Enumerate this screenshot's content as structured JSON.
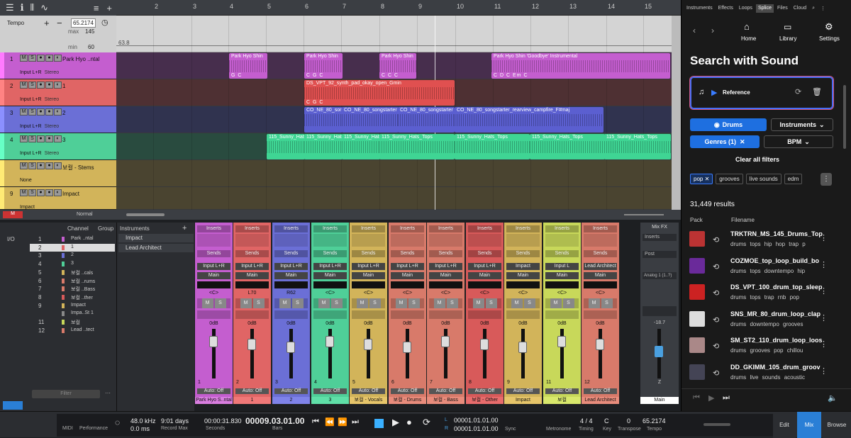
{
  "ruler": {
    "bars": [
      "2",
      "3",
      "4",
      "5",
      "6",
      "7",
      "8",
      "9",
      "10",
      "11",
      "12",
      "13",
      "14",
      "15"
    ]
  },
  "tempo": {
    "label": "Tempo",
    "value": "65.2174",
    "max_label": "max",
    "max": "145",
    "min_label": "min",
    "min": "60",
    "lane_value": "63.8"
  },
  "tracks": [
    {
      "num": "1",
      "name": "Park Hyo ..ntal",
      "input": "Input L+R",
      "mode": "Stereo",
      "color": "#c45ecf"
    },
    {
      "num": "2",
      "name": "1",
      "input": "Input L+R",
      "mode": "Stereo",
      "color": "#e06565"
    },
    {
      "num": "3",
      "name": "2",
      "input": "Input L+R",
      "mode": "Stereo",
      "color": "#6b6fd6"
    },
    {
      "num": "4",
      "name": "3",
      "input": "Input L+R",
      "mode": "Stereo",
      "color": "#4fcf98"
    },
    {
      "num": "",
      "name": "보컬 - Stems",
      "input": "None",
      "mode": "",
      "color": "#d2b45a"
    },
    {
      "num": "9",
      "name": "Impact",
      "input": "Impact",
      "mode": "",
      "color": "#d2b45a"
    }
  ],
  "clips": {
    "park": "Park Hyo Shin",
    "park_goodbye": "Park Hyo Shin 'Goodbye' Instrumental",
    "synth": "DS_VPT_92_synth_pad_okay_open_Gmin",
    "co_short": "CO_NE_80_sor",
    "co_song": "CO_NE_80_songstarter",
    "co_full": "CO_NE_80_songstarter_rearview_campfire_F#maj",
    "hats_a": "115_Sunny_Hats",
    "hats_b": "115_Sunny_Hats_Tops",
    "chords_1": "G  C",
    "chords_2": "C  G  C",
    "chords_3": "Em",
    "chords_4": "C  D  C  Em  C",
    "chords_5": "C  C  C"
  },
  "arrange_bottom": {
    "mode": "Normal"
  },
  "console": {
    "channel_col": "Channel",
    "group_col": "Group",
    "instruments_title": "Instruments",
    "instruments": [
      "Impact",
      "Lead Architect"
    ],
    "io": "I/O",
    "channels": [
      {
        "n": "1",
        "name": "Park ..ntal"
      },
      {
        "n": "2",
        "name": "1"
      },
      {
        "n": "3",
        "name": "2"
      },
      {
        "n": "4",
        "name": "3"
      },
      {
        "n": "5",
        "name": "보컬 ..cals"
      },
      {
        "n": "6",
        "name": "보컬 ..rums"
      },
      {
        "n": "7",
        "name": "보컬 ..Bass"
      },
      {
        "n": "8",
        "name": "보컬 ..ther"
      },
      {
        "n": "9",
        "name": "Impact"
      },
      {
        "n": "",
        "name": "Impa..St 1"
      },
      {
        "n": "11",
        "name": "보컬"
      },
      {
        "n": "12",
        "name": "Lead ..tect"
      }
    ],
    "filter_placeholder": "Filter",
    "strip_inserts": "Inserts",
    "strip_sends": "Sends",
    "strip_main": "Main",
    "strip_auto": "Auto: Off",
    "strip_db": "0dB",
    "strips": [
      {
        "n": "1",
        "input": "Input L+R",
        "pan": "<C>",
        "name": "Park Hyo S..ntal",
        "color": "#c45ecf",
        "nc": "#d97ee0"
      },
      {
        "n": "2",
        "input": "Input L+R",
        "pan": "L70",
        "name": "1",
        "color": "#e06565",
        "nc": "#f07878"
      },
      {
        "n": "3",
        "input": "Input L+R",
        "pan": "R62",
        "name": "2",
        "color": "#6b6fd6",
        "nc": "#7f83ea"
      },
      {
        "n": "4",
        "input": "Input L+R",
        "pan": "<C>",
        "name": "3",
        "color": "#4fcf98",
        "nc": "#5fe0a8"
      },
      {
        "n": "5",
        "input": "Input L+R",
        "pan": "<C>",
        "name": "보컬 - Vocals",
        "color": "#d2b45a",
        "nc": "#e6c56a"
      },
      {
        "n": "6",
        "input": "Input L+R",
        "pan": "<C>",
        "name": "보컬 - Drums",
        "color": "#d87a6a",
        "nc": "#e88c7c"
      },
      {
        "n": "7",
        "input": "Input L+R",
        "pan": "<C>",
        "name": "보컬 - Bass",
        "color": "#d87a6a",
        "nc": "#e88c7c"
      },
      {
        "n": "8",
        "input": "Input L+R",
        "pan": "<C>",
        "name": "보컬 - Other",
        "color": "#d85a5a",
        "nc": "#e86c6c"
      },
      {
        "n": "9",
        "input": "Impact",
        "pan": "<C>",
        "name": "Impact",
        "color": "#d2b45a",
        "nc": "#e6c56a"
      },
      {
        "n": "11",
        "input": "Input L",
        "pan": "<C>",
        "name": "보컬",
        "color": "#c8d85a",
        "nc": "#d8e86c"
      },
      {
        "n": "12",
        "input": "Lead Architect",
        "pan": "<C>",
        "name": "Lead Architect",
        "color": "#d87a6a",
        "nc": "#e88c7c"
      }
    ],
    "mixfx": {
      "title": "Mix FX",
      "inserts": "Inserts",
      "post": "Post",
      "analog": "Analog 1 (1..?)",
      "db": "-18.7",
      "name": "Main",
      "n": "Z"
    }
  },
  "splice": {
    "tabs": [
      "Instruments",
      "Effects",
      "Loops",
      "Splice",
      "Files",
      "Cloud"
    ],
    "active_tab": "Splice",
    "nav": {
      "home": "Home",
      "library": "Library",
      "settings": "Settings"
    },
    "heading": "Search with Sound",
    "reference": "Reference",
    "filters": {
      "drums": "Drums",
      "instruments": "Instruments",
      "genres": "Genres (1)",
      "bpm": "BPM",
      "clear": "Clear all filters"
    },
    "tags": [
      "pop",
      "grooves",
      "live sounds",
      "edm"
    ],
    "results_count": "31,449 results",
    "col_pack": "Pack",
    "col_filename": "Filename",
    "results": [
      {
        "name": "TRKTRN_MS_145_Drums_Top",
        "tags": "drums  tops  hip hop  trap  p",
        "thumb": "#b33"
      },
      {
        "name": "COZMOE_top_loop_build_bo",
        "tags": "drums  tops  downtempo  hip",
        "thumb": "#6a2a9a"
      },
      {
        "name": "DS_VPT_100_drum_top_sleep",
        "tags": "drums  tops  trap  rnb  pop",
        "thumb": "#c22"
      },
      {
        "name": "SNS_MR_80_drum_loop_clap",
        "tags": "drums  downtempo  grooves",
        "thumb": "#ddd"
      },
      {
        "name": "SM_ST2_110_drum_loop_loos",
        "tags": "drums  grooves  pop  chillou",
        "thumb": "#a88"
      },
      {
        "name": "DD_GKIMM_105_drum_groov",
        "tags": "drums  live sounds  acoustic",
        "thumb": "#445"
      }
    ]
  },
  "transport": {
    "midi": "MIDI",
    "performance": "Performance",
    "sample_rate": "48.0 kHz",
    "latency": "0.0 ms",
    "record_days": "9:01 days",
    "record_max": "Record Max",
    "seconds_val": "00:00:31.830",
    "seconds_lbl": "Seconds",
    "bars_val": "00009.03.01.00",
    "bars_lbl": "Bars",
    "l_val": "00001.01.01.00",
    "r_val": "00001.01.01.00",
    "sync": "Sync",
    "metronome": "Metronome",
    "timing_val": "4 / 4",
    "timing_lbl": "Timing",
    "key_val": "C",
    "key_lbl": "Key",
    "transpose_val": "0",
    "transpose_lbl": "Transpose",
    "tempo_val": "65.2174",
    "tempo_lbl": "Tempo",
    "edit": "Edit",
    "mix": "Mix",
    "browse": "Browse"
  }
}
